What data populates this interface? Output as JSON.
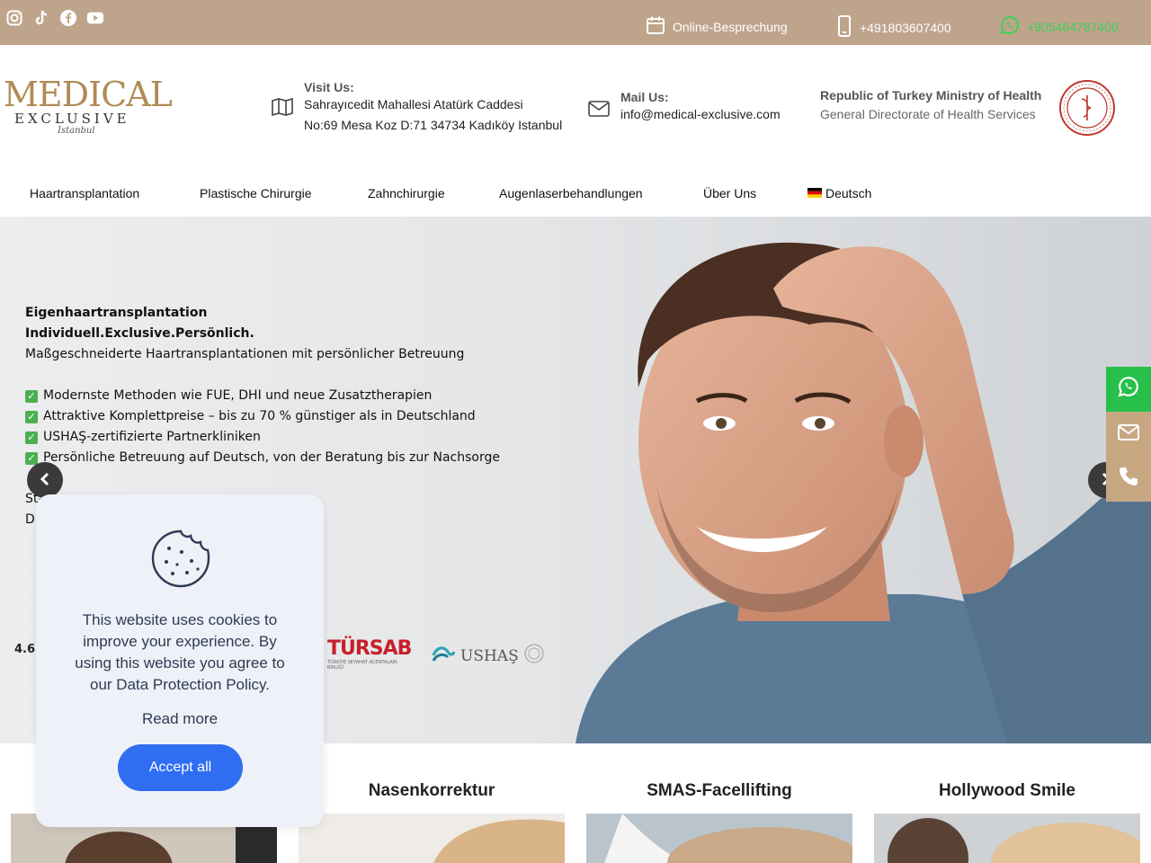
{
  "topbar": {
    "social_icons": [
      "instagram-icon",
      "tiktok-icon",
      "facebook-icon",
      "youtube-icon"
    ],
    "meeting": "Online-Besprechung",
    "phone": "+491803607400",
    "whatsapp": "+905464787400"
  },
  "header": {
    "logo": {
      "line1": "MEDICAL",
      "line2": "EXCLUSIVE",
      "line3": "Istanbul"
    },
    "visit": {
      "title": "Visit Us:",
      "line1": "Sahrayıcedit Mahallesi Atatürk Caddesi",
      "line2": "No:69 Mesa Koz D:71 34734 Kadıköy Istanbul"
    },
    "mail": {
      "title": "Mail Us:",
      "value": "info@medical-exclusive.com"
    },
    "ministry": {
      "title": "Republic of Turkey Ministry of Health",
      "subtitle": "General Directorate of Health Services"
    }
  },
  "nav": {
    "items": [
      "Haartransplantation",
      "Plastische Chirurgie",
      "Zahnchirurgie",
      "Augenlaserbehandlungen",
      "Über Uns",
      "Deutsch"
    ]
  },
  "hero": {
    "line1": "Eigenhaartransplantation",
    "line2": "Individuell.Exclusive.Persönlich.",
    "line3": "Maßgeschneiderte Haartransplantationen mit persönlicher Betreuung",
    "bullets": [
      "Modernste Methoden wie FUE, DHI und neue Zusatztherapien",
      "Attraktive Komplettpreise – bis zu 70 % günstiger als in Deutschland",
      "USHAŞ-zertifizierte Partnerkliniken",
      "Persönliche Betreuung auf Deutsch, von der Beratung bis zur Nachsorge"
    ],
    "partial1": "Sta",
    "partial2": "Di",
    "rating": "4.6",
    "tursab": "TÜRSAB",
    "tursab_sub": "TÜRKİYE SEYAHAT ACENTALARI BİRLİĞİ",
    "ushas": "USHAŞ"
  },
  "side_contacts": [
    "whatsapp-icon",
    "mail-icon",
    "phone-icon"
  ],
  "side_colors": {
    "whatsapp": "#27c04a",
    "mail": "#c7a782",
    "phone": "#c7a782"
  },
  "cards": [
    "Nasenkorrektur",
    "SMAS-Facellifting",
    "Hollywood Smile"
  ],
  "cookie": {
    "text": "This website uses cookies to improve your experience. By using this website you agree to our Data Protection Policy.",
    "read_more": "Read more",
    "accept": "Accept all"
  }
}
